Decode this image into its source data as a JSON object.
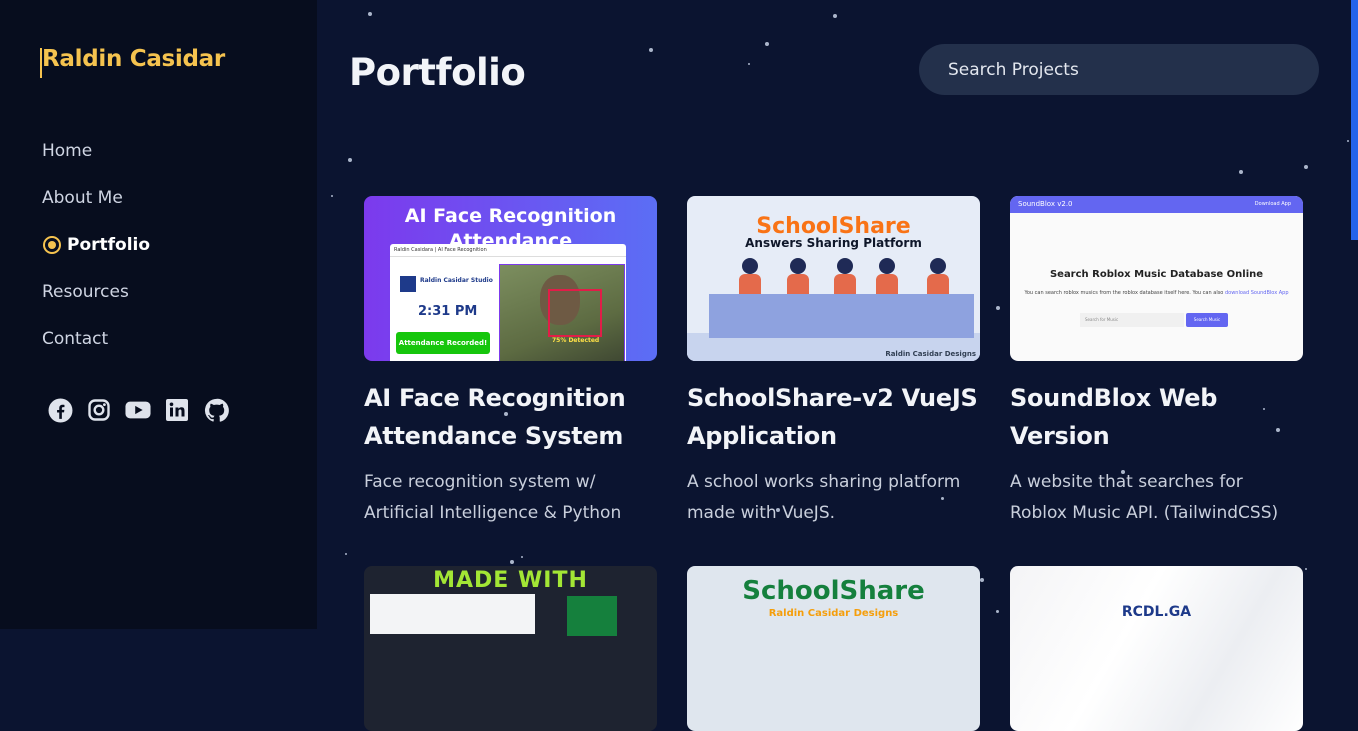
{
  "sidebar": {
    "brand": "Raldin Casidar",
    "nav": [
      {
        "label": "Home",
        "active": false
      },
      {
        "label": "About Me",
        "active": false
      },
      {
        "label": "Portfolio",
        "active": true
      },
      {
        "label": "Resources",
        "active": false
      },
      {
        "label": "Contact",
        "active": false
      }
    ],
    "socials": [
      "facebook-icon",
      "instagram-icon",
      "youtube-icon",
      "linkedin-icon",
      "github-icon"
    ]
  },
  "main": {
    "title": "Portfolio",
    "search_placeholder": "Search Projects"
  },
  "projects": [
    {
      "title": "AI Face Recognition Attendance System",
      "description": "Face recognition system w/ Artificial Intelligence & Python",
      "thumb": {
        "heading": "AI Face Recognition Attendance",
        "window_bar": "Raldin Casidara | AI Face Recognition",
        "studio": "Raldin Casidar Studio",
        "time": "2:31 PM",
        "status": "Attendance Recorded!",
        "detection": "75% Detected"
      }
    },
    {
      "title": "SchoolShare-v2 VueJS Application",
      "description": "A school works sharing platform made with VueJS.",
      "thumb": {
        "heading": "SchoolShare",
        "subheading": "Answers Sharing Platform",
        "signature": "Raldin Casidar Designs"
      }
    },
    {
      "title": "SoundBlox Web Version",
      "description": "A website that searches for Roblox Music API. (TailwindCSS)",
      "thumb": {
        "nav_title": "SoundBlox v2.0",
        "nav_link": "Download App",
        "heading": "Search Roblox Music Database Online",
        "subtext": "You can search roblox musics from the roblox database itself here. You can also",
        "subtext_link": "download SoundBlox App",
        "input_placeholder": "Search for Music",
        "button": "Search Music"
      }
    },
    {
      "thumb": {
        "heading": "MADE WITH"
      }
    },
    {
      "thumb": {
        "heading": "SchoolShare",
        "subheading": "Raldin Casidar Designs"
      }
    },
    {
      "thumb": {
        "heading": "RCDL.GA"
      }
    }
  ],
  "colors": {
    "accent": "#f5c34f",
    "background": "#0b1430",
    "sidebar": "#070d1e",
    "search_bg": "#23304b"
  }
}
